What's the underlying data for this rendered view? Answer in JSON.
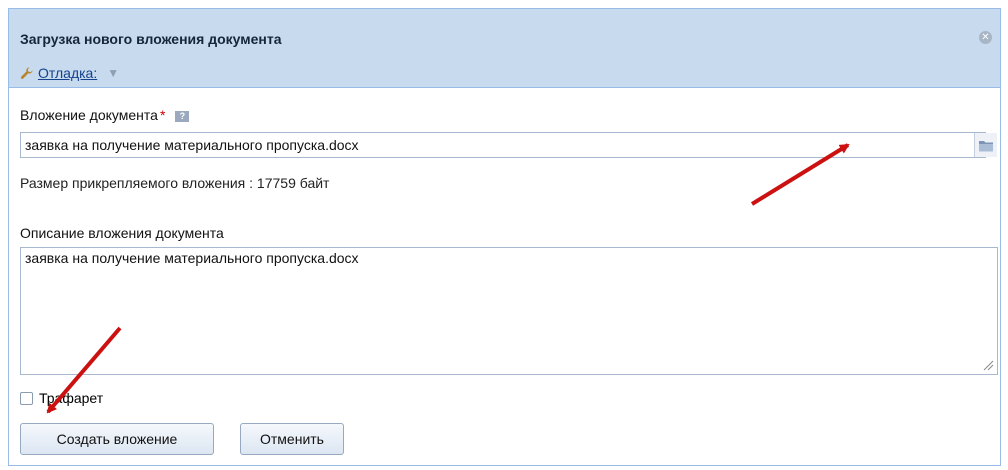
{
  "dialog": {
    "title": "Загрузка нового вложения документа",
    "close_icon": "close-icon",
    "debug_label": "Отладка:"
  },
  "attachment": {
    "label": "Вложение документа",
    "required_mark": "*",
    "help_glyph": "?",
    "value": "заявка на получение материального пропуска.docx",
    "size_text": "Размер прикрепляемого вложения : 17759 байт"
  },
  "description": {
    "label": "Описание вложения документа",
    "value": "заявка на получение материального пропуска.docx"
  },
  "template": {
    "label": "Трафарет",
    "checked": false
  },
  "buttons": {
    "create": "Создать вложение",
    "cancel": "Отменить"
  },
  "colors": {
    "header_bg": "#c8daee",
    "arrow": "#cc1111"
  }
}
